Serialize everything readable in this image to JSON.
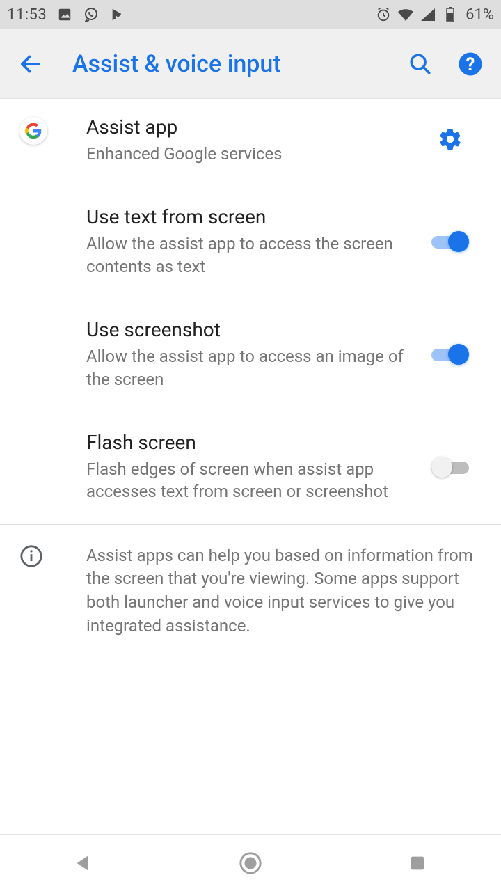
{
  "status": {
    "time": "11:53",
    "battery_pct": "61%"
  },
  "appbar": {
    "title": "Assist & voice input"
  },
  "rows": {
    "assist": {
      "title": "Assist app",
      "subtitle": "Enhanced Google services"
    },
    "use_text": {
      "title": "Use text from screen",
      "subtitle": "Allow the assist app to access the screen contents as text",
      "on": true
    },
    "use_screenshot": {
      "title": "Use screenshot",
      "subtitle": "Allow the assist app to access an image of the screen",
      "on": true
    },
    "flash": {
      "title": "Flash screen",
      "subtitle": "Flash edges of screen when assist app accesses text from screen or screenshot",
      "on": false
    }
  },
  "info": "Assist apps can help you based on information from the screen that you're viewing. Some apps support both launcher and voice input services to give you integrated assistance.",
  "colors": {
    "accent": "#1a73e8"
  }
}
